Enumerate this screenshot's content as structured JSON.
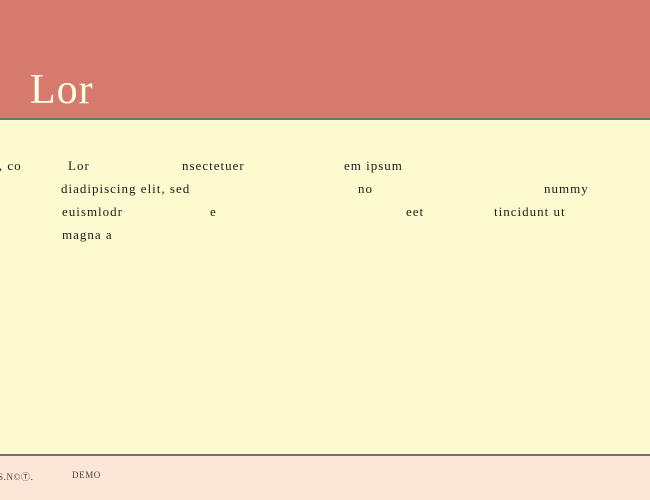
{
  "header": {
    "title": "Lor"
  },
  "body": {
    "r1a": "net,  co",
    "r1b": "Lor",
    "r1c": "nsectetuer",
    "r1d": "em ipsum",
    "r2a": "diadipiscing elit,  sed",
    "r2b": "no",
    "r2c": "nummy",
    "r3a": "euismlodr",
    "r3b": "e",
    "r3c": "eet",
    "r3d": "tincidunt ut",
    "r4a": ".",
    "r4b": "magna a"
  },
  "footer": {
    "left": "S.N©Ⓣ.",
    "demo": "DEMO"
  }
}
